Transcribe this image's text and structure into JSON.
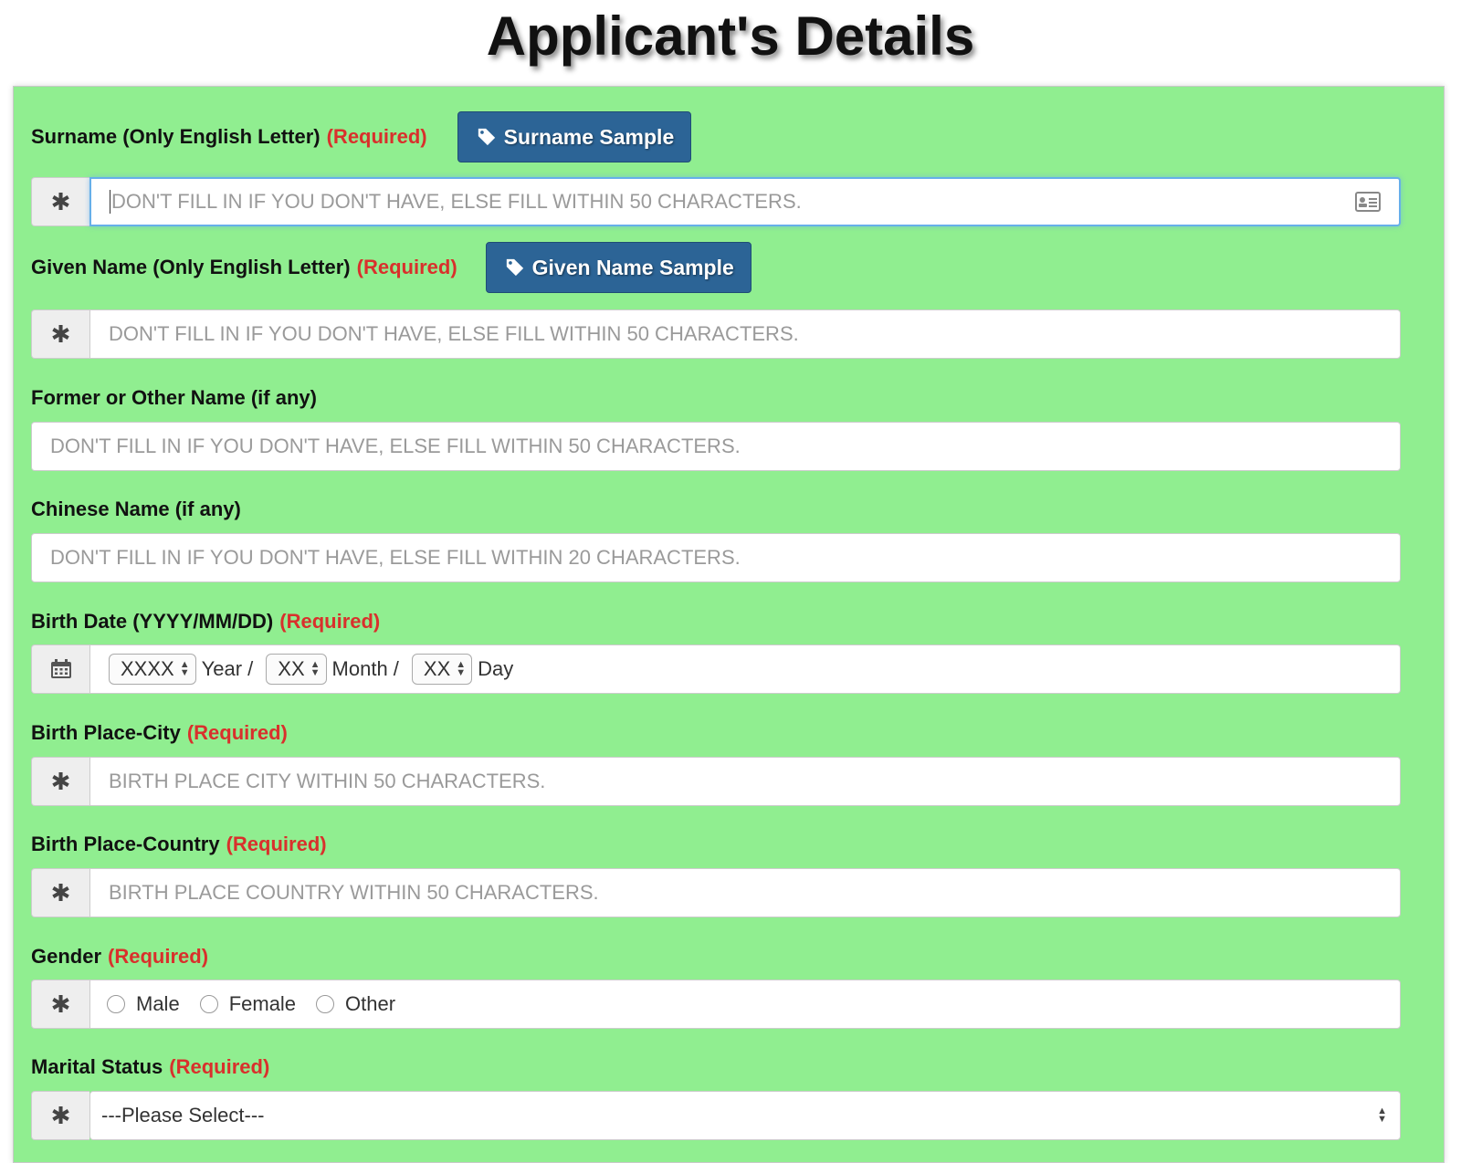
{
  "page": {
    "title": "Applicant's Details"
  },
  "icons": {
    "asterisk": "asterisk-icon",
    "calendar": "calendar-icon",
    "tag": "tag-icon",
    "id_card": "id-card-icon"
  },
  "colors": {
    "panel_bg": "#90ee90",
    "required": "#d9302c",
    "button_bg": "#2c6496"
  },
  "required_text": "(Required)",
  "surname": {
    "label": "Surname (Only English Letter)",
    "sample_button": "Surname Sample",
    "placeholder": "DON'T FILL IN IF YOU DON'T HAVE, ELSE FILL WITHIN 50 CHARACTERS."
  },
  "given_name": {
    "label": "Given Name (Only English Letter)",
    "sample_button": "Given Name Sample",
    "placeholder": "DON'T FILL IN IF YOU DON'T HAVE, ELSE FILL WITHIN 50 CHARACTERS."
  },
  "former_name": {
    "label": "Former or Other Name (if any)",
    "placeholder": "DON'T FILL IN IF YOU DON'T HAVE, ELSE FILL WITHIN 50 CHARACTERS."
  },
  "chinese_name": {
    "label": "Chinese Name (if any)",
    "placeholder": "DON'T FILL IN IF YOU DON'T HAVE, ELSE FILL WITHIN 20 CHARACTERS."
  },
  "birth_date": {
    "label": "Birth Date (YYYY/MM/DD)",
    "year_value": "XXXX",
    "year_unit": "Year /",
    "month_value": "XX",
    "month_unit": "Month /",
    "day_value": "XX",
    "day_unit": "Day"
  },
  "birth_city": {
    "label": "Birth Place-City",
    "placeholder": "BIRTH PLACE CITY WITHIN 50 CHARACTERS."
  },
  "birth_country": {
    "label": "Birth Place-Country",
    "placeholder": "BIRTH PLACE COUNTRY WITHIN 50 CHARACTERS."
  },
  "gender": {
    "label": "Gender",
    "options": [
      "Male",
      "Female",
      "Other"
    ]
  },
  "marital_status": {
    "label": "Marital Status",
    "selected": "---Please Select---"
  }
}
